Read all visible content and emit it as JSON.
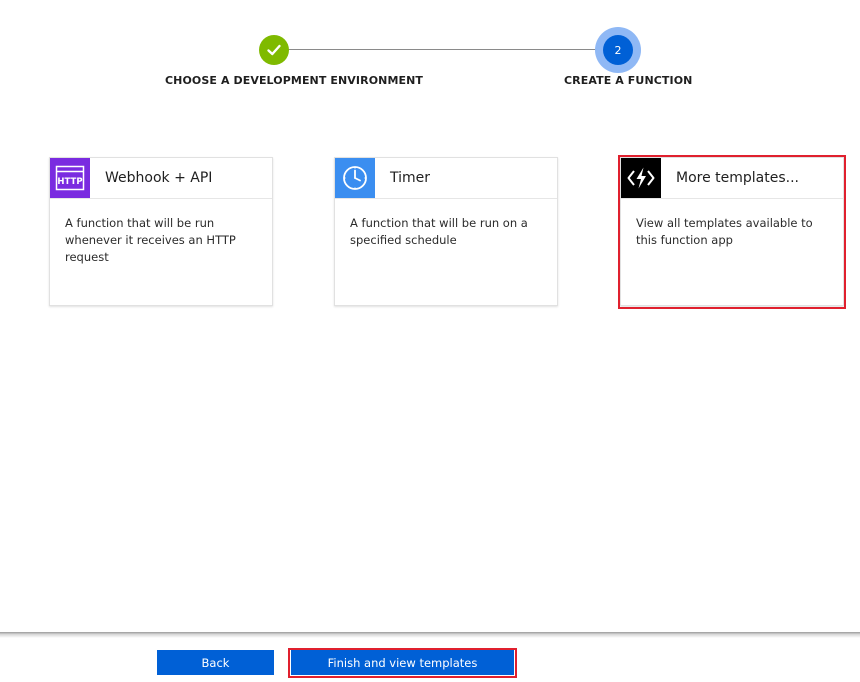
{
  "stepper": {
    "steps": [
      {
        "label": "CHOOSE A DEVELOPMENT ENVIRONMENT",
        "status": "completed"
      },
      {
        "number": "2",
        "label": "CREATE A FUNCTION",
        "status": "current"
      }
    ]
  },
  "cards": [
    {
      "icon": "http-icon",
      "icon_text": "HTTP",
      "title": "Webhook + API",
      "description": "A function that will be run whenever it receives an HTTP request"
    },
    {
      "icon": "clock-icon",
      "title": "Timer",
      "description": "A function that will be run on a specified schedule"
    },
    {
      "icon": "function-bolt-icon",
      "title": "More templates...",
      "description": "View all templates available to this function app",
      "highlighted": true
    }
  ],
  "footer": {
    "back_label": "Back",
    "finish_label": "Finish and view templates"
  },
  "colors": {
    "completed_green": "#7fba00",
    "current_blue": "#0060d6",
    "current_halo": "#8fb8f5",
    "http_purple": "#7a2be0",
    "timer_blue": "#3b8ef0",
    "highlight_red": "#e0202e",
    "button_blue": "#0060d6"
  }
}
